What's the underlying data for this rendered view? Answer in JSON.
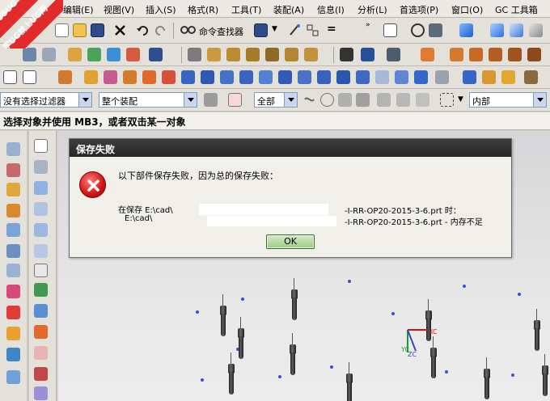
{
  "watermark": {
    "line1": "9SUG",
    "line2": "学UG就上UG网"
  },
  "menu": [
    {
      "label": "编辑(E)"
    },
    {
      "label": "视图(V)"
    },
    {
      "label": "插入(S)"
    },
    {
      "label": "格式(R)"
    },
    {
      "label": "工具(T)"
    },
    {
      "label": "装配(A)"
    },
    {
      "label": "信息(I)"
    },
    {
      "label": "分析(L)"
    },
    {
      "label": "首选项(P)"
    },
    {
      "label": "窗口(O)"
    },
    {
      "label": "GC 工具箱"
    }
  ],
  "toolbar": {
    "command_finder_label": "命令查找器",
    "selection_filter": "没有选择过滤器",
    "assembly_scope": "整个装配",
    "all_filter": "全部",
    "internal_filter": "内部"
  },
  "cue_line": "选择对象并使用 MB3，或者双击某一对象",
  "dialog": {
    "title": "保存失败",
    "message": "以下部件保存失败，因为总的保存失败：",
    "detail_line1_prefix": "在保存 E:\\cad\\",
    "detail_line1_suffix": "-I-RR-OP20-2015-3-6.prt 时：",
    "detail_line2_prefix": "E:\\cad\\",
    "detail_line2_suffix": "-I-RR-OP20-2015-3-6.prt - 内存不足",
    "ok_label": "OK"
  },
  "triad": {
    "xc": "XC",
    "yc": "YC",
    "zc": "ZC"
  },
  "colors": {
    "error_red": "#d21414",
    "title_bar": "#2b2b2b",
    "ok_green": "#9bcb84",
    "watermark_red": "#e12b2b",
    "point_blue": "#3b4ed8"
  }
}
